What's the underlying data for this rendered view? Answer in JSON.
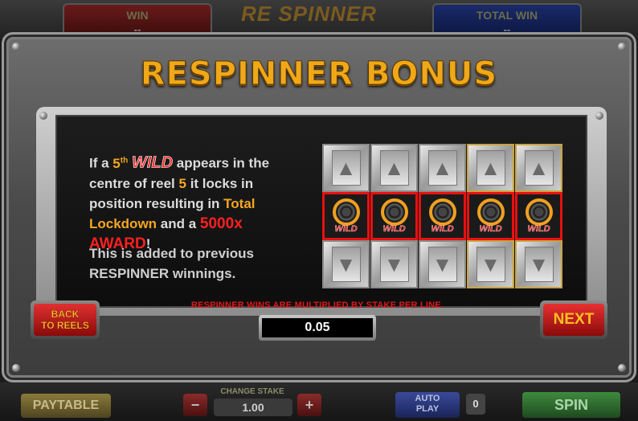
{
  "background": {
    "win_label": "WIN",
    "win_value": "--",
    "total_win_label": "TOTAL WIN",
    "total_win_value": "--",
    "logo_text": "RE SPINNER",
    "paytable_label": "PAYTABLE",
    "change_stake_label": "CHANGE STAKE",
    "stake_value": "1.00",
    "minus_label": "−",
    "plus_label": "+",
    "autoplay_label_1": "AUTO",
    "autoplay_label_2": "PLAY",
    "autoplay_count": "0",
    "spin_label": "SPIN"
  },
  "popup": {
    "title": "RESPINNER BONUS",
    "desc": {
      "p1_if_a": "If a ",
      "p1_num": "5",
      "p1_sup": "th",
      "p1_wild": "WILD",
      "p1_appears": " appears in the centre of reel ",
      "p1_reel": "5",
      "p1_locks": " it locks in position resulting in ",
      "p1_lockdown": "Total Lockdown",
      "p1_and": " and a ",
      "p1_award": "5000x AWARD",
      "p1_end": "!",
      "p2": "This is added to previous RESPINNER winnings."
    },
    "reels": {
      "wild_label": "WILD",
      "up_arrow": "▲",
      "down_arrow": "▼"
    },
    "back_button_line1": "BACK",
    "back_button_line2": "TO REELS",
    "next_button": "NEXT",
    "note": "RESPINNER WINS ARE MULTIPLIED BY STAKE PER LINE.",
    "stake_per_line": "0.05"
  },
  "colors": {
    "title_gold": "#f0a818",
    "accent_orange": "#f5a623",
    "wild_red": "#ff3030",
    "button_red": "#e03030"
  }
}
